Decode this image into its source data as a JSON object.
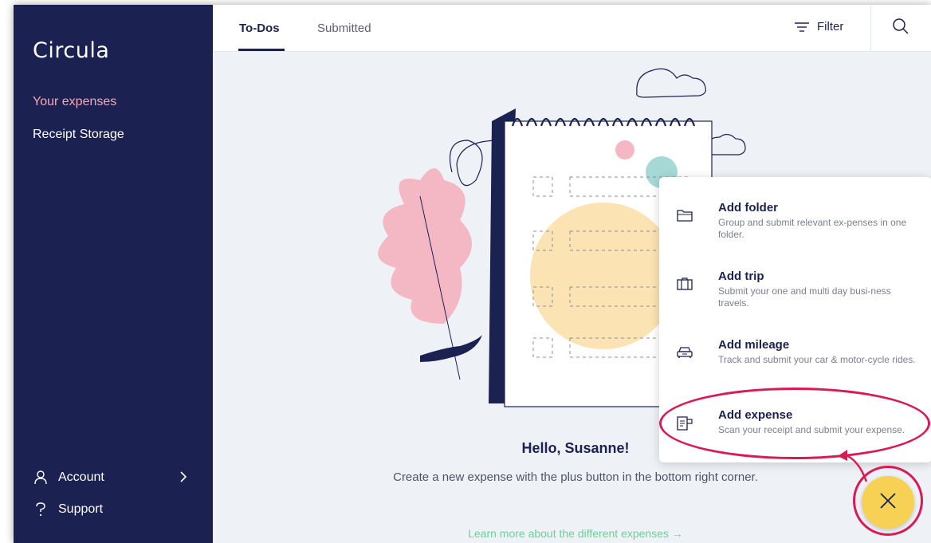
{
  "sidebar": {
    "logo": "Circula",
    "nav": [
      {
        "label": "Your expenses",
        "active": true
      },
      {
        "label": "Receipt Storage",
        "active": false
      }
    ],
    "account_label": "Account",
    "support_label": "Support"
  },
  "tabs": [
    {
      "label": "To-Dos",
      "active": true
    },
    {
      "label": "Submitted",
      "active": false
    }
  ],
  "toolbar": {
    "filter_label": "Filter"
  },
  "empty_state": {
    "greeting": "Hello, Susanne!",
    "message": "Create a new expense with the plus button in the bottom right corner.",
    "learn_more": "Learn more about the different expenses →"
  },
  "add_menu": {
    "items": [
      {
        "title": "Add folder",
        "description": "Group and submit relevant ex-penses in one folder.",
        "icon": "folder-icon"
      },
      {
        "title": "Add trip",
        "description": "Submit your one and multi day busi-ness travels.",
        "icon": "suitcase-icon"
      },
      {
        "title": "Add mileage",
        "description": "Track and submit your car & motor-cycle rides.",
        "icon": "car-icon"
      },
      {
        "title": "Add expense",
        "description": "Scan your receipt and submit your expense.",
        "icon": "receipt-icon"
      }
    ]
  },
  "colors": {
    "sidebar_bg": "#1b2150",
    "active_nav": "#f7a7b8",
    "fab": "#f7d154",
    "highlight": "#d81b55",
    "link": "#6fcf97"
  }
}
